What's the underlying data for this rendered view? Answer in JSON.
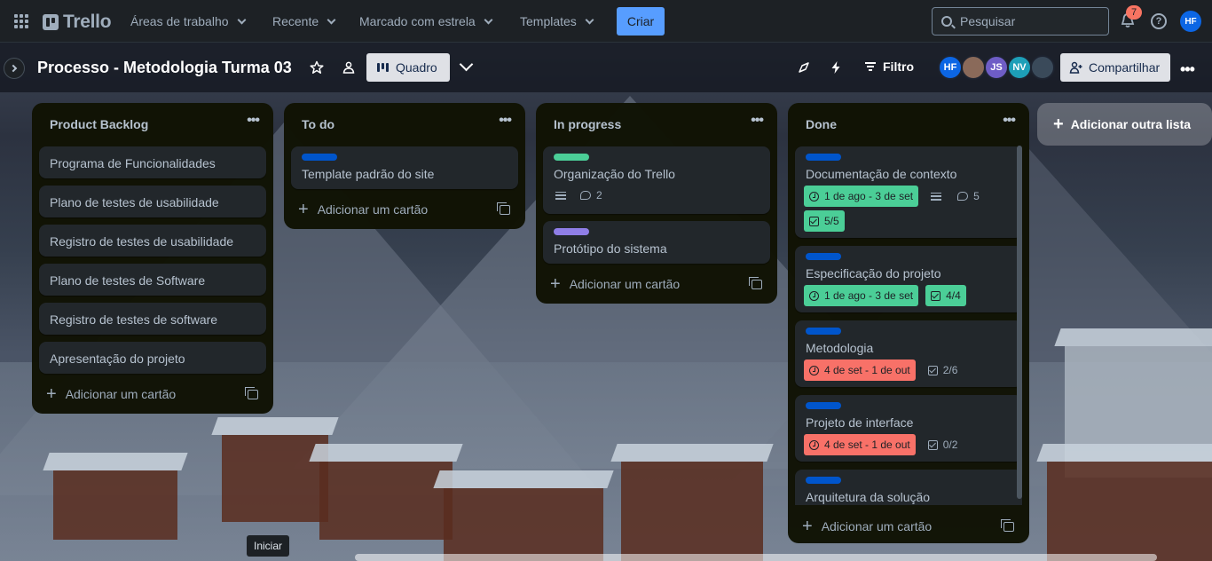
{
  "topbar": {
    "logo_text": "Trello",
    "nav": [
      "Áreas de trabalho",
      "Recente",
      "Marcado com estrela",
      "Templates"
    ],
    "create_label": "Criar",
    "search_placeholder": "Pesquisar",
    "notifications_count": "7",
    "help_glyph": "?",
    "user_initials": "HF"
  },
  "board": {
    "title": "Processo - Metodologia Turma 03",
    "view_label": "Quadro",
    "filter_label": "Filtro",
    "share_label": "Compartilhar",
    "members": [
      {
        "initials": "HF",
        "color": "#0c66e4"
      },
      {
        "initials": "",
        "color": "#8a6a5a"
      },
      {
        "initials": "JS",
        "color": "#6e5dc6"
      },
      {
        "initials": "NV",
        "color": "#1d9fb8"
      },
      {
        "initials": "",
        "color": "#3a4a5a"
      }
    ]
  },
  "lists": [
    {
      "title": "Product Backlog",
      "cards": [
        {
          "title": "Programa de Funcionalidades"
        },
        {
          "title": "Plano de testes de usabilidade"
        },
        {
          "title": "Registro de testes de usabilidade"
        },
        {
          "title": "Plano de testes de Software"
        },
        {
          "title": "Registro de testes de software"
        },
        {
          "title": "Apresentação do projeto"
        }
      ],
      "add_label": "Adicionar um cartão"
    },
    {
      "title": "To do",
      "cards": [
        {
          "title": "Template padrão do site",
          "label_color": "#0055cc"
        }
      ],
      "add_label": "Adicionar um cartão"
    },
    {
      "title": "In progress",
      "cards": [
        {
          "title": "Organização do Trello",
          "label_color": "#4bce97",
          "comments": "2"
        },
        {
          "title": "Protótipo do sistema",
          "label_color": "#8f7ee7"
        }
      ],
      "add_label": "Adicionar um cartão"
    },
    {
      "title": "Done",
      "cards": [
        {
          "title": "Documentação de contexto",
          "label_color": "#0055cc",
          "due": "1 de ago - 3 de set",
          "comments": "5",
          "checklist": "5/5"
        },
        {
          "title": "Especificação do projeto",
          "label_color": "#0055cc",
          "due": "1 de ago - 3 de set",
          "checklist": "4/4"
        },
        {
          "title": "Metodologia",
          "label_color": "#0055cc",
          "due": "4 de set - 1 de out",
          "checklist": "2/6"
        },
        {
          "title": "Projeto de interface",
          "label_color": "#0055cc",
          "due": "4 de set - 1 de out",
          "checklist": "0/2"
        },
        {
          "title": "Arquitetura da solução",
          "label_color": "#0055cc"
        }
      ],
      "add_label": "Adicionar um cartão"
    }
  ],
  "add_list_label": "Adicionar outra lista",
  "tooltip": "Iniciar",
  "colors": {
    "accent": "#579dff",
    "due_green": "#4bce97",
    "due_red": "#f87168"
  }
}
